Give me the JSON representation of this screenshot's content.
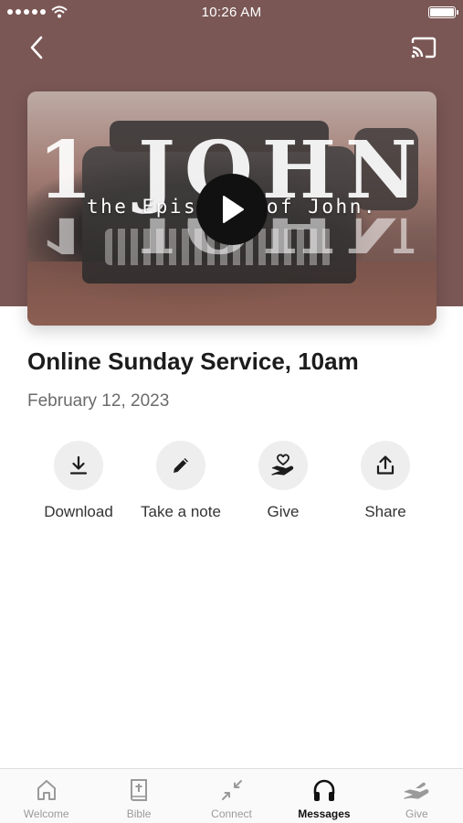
{
  "status_bar": {
    "time": "10:26 AM"
  },
  "video": {
    "title_art": "1 JOHN",
    "subtitle_art": "the Epistles of John."
  },
  "message": {
    "title": "Online Sunday Service, 10am",
    "date": "February 12, 2023"
  },
  "actions": [
    {
      "label": "Download",
      "icon": "download-icon"
    },
    {
      "label": "Take a note",
      "icon": "pencil-icon"
    },
    {
      "label": "Give",
      "icon": "heart-hand-icon"
    },
    {
      "label": "Share",
      "icon": "share-icon"
    }
  ],
  "tabs": [
    {
      "label": "Welcome",
      "icon": "home-icon",
      "active": false
    },
    {
      "label": "Bible",
      "icon": "bible-icon",
      "active": false
    },
    {
      "label": "Connect",
      "icon": "connect-icon",
      "active": false
    },
    {
      "label": "Messages",
      "icon": "headphones-icon",
      "active": true
    },
    {
      "label": "Give",
      "icon": "give-hand-icon",
      "active": false
    }
  ],
  "colors": {
    "hero_background": "#7a5755",
    "action_circle": "#eeeeee",
    "tab_inactive": "#9a9a9a",
    "tab_active": "#111111"
  }
}
